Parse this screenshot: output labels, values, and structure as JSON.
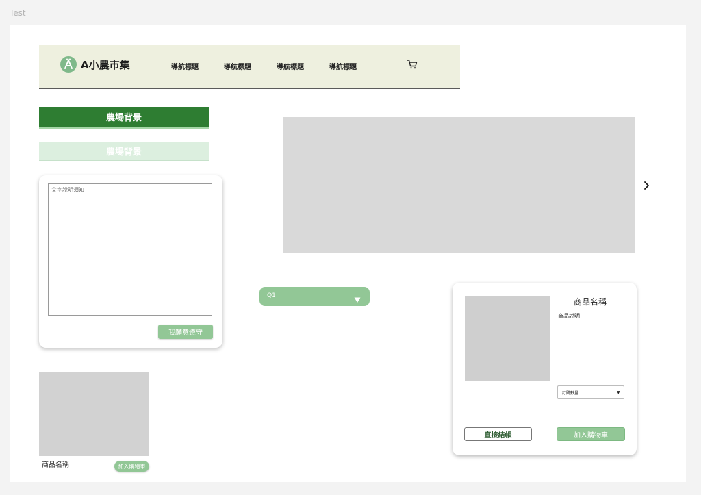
{
  "frame": {
    "label": "Test"
  },
  "header": {
    "logo_text": "A小農市集",
    "nav_items": [
      "導航標題",
      "導航標題",
      "導航標題",
      "導航標題"
    ]
  },
  "farm_buttons": {
    "active_label": "農場背景",
    "inactive_label": "農場背景"
  },
  "terms_card": {
    "textarea_placeholder": "文字說明須知",
    "agree_label": "我願意遵守"
  },
  "small_product": {
    "name": "商品名稱",
    "add_label": "加入購物車"
  },
  "question_dropdown": {
    "selected": "Q1"
  },
  "product_detail": {
    "name": "商品名稱",
    "description": "商品說明",
    "quantity_label": "訂購數量",
    "checkout_label": "直接結帳",
    "add_to_cart_label": "加入購物車"
  },
  "colors": {
    "header_bg": "#eef0df",
    "primary_green": "#2e7d32",
    "light_green": "#92c796",
    "pale_green": "#dcefdf",
    "placeholder_gray": "#d9d9d9"
  },
  "icons": [
    "logo-icon",
    "cart-icon",
    "chevron-right-icon",
    "caret-down-icon"
  ]
}
